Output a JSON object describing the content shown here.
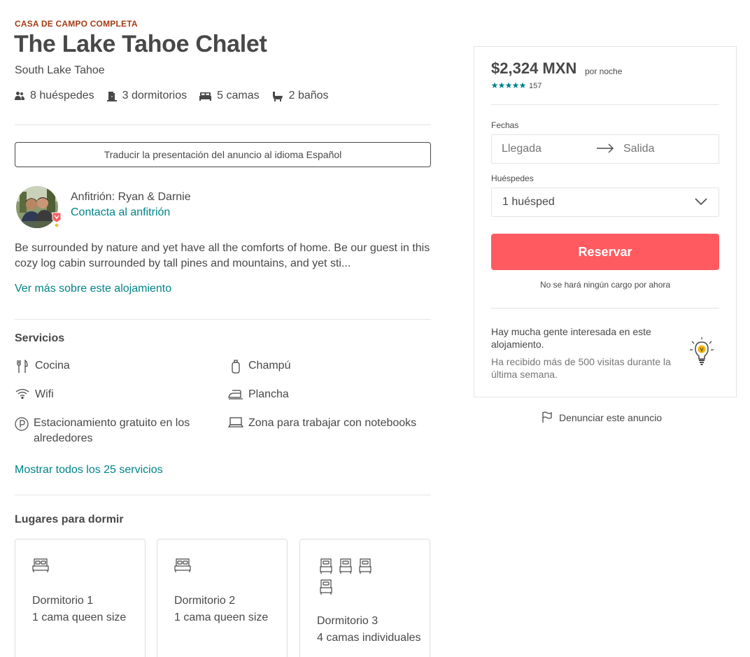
{
  "listing": {
    "kind": "CASA DE CAMPO COMPLETA",
    "title": "The Lake Tahoe Chalet",
    "location": "South Lake Tahoe",
    "summary": [
      {
        "icon": "guests-icon",
        "label": "8 huéspedes"
      },
      {
        "icon": "door-icon",
        "label": "3 dormitorios"
      },
      {
        "icon": "bed-icon",
        "label": "5 camas"
      },
      {
        "icon": "bath-icon",
        "label": "2 baños"
      }
    ],
    "translate_button": "Traducir la presentación del anuncio al idioma Español"
  },
  "host": {
    "name": "Anfitrión: Ryan & Darnie",
    "contact": "Contacta al anfitrión"
  },
  "description": {
    "text": "Be surrounded by nature and yet have all the comforts of home. Be our guest in this cozy log cabin surrounded by tall pines and mountains, and yet sti...",
    "read_more": "Ver más sobre este alojamiento"
  },
  "services": {
    "title": "Servicios",
    "items": [
      {
        "icon": "utensils-icon",
        "label": "Cocina"
      },
      {
        "icon": "shampoo-icon",
        "label": "Champú"
      },
      {
        "icon": "wifi-icon",
        "label": "Wifi"
      },
      {
        "icon": "iron-icon",
        "label": "Plancha"
      },
      {
        "icon": "parking-icon",
        "label": "Estacionamiento gratuito en los alrededores"
      },
      {
        "icon": "laptop-icon",
        "label": "Zona para trabajar con notebooks"
      }
    ],
    "show_all": "Mostrar todos los 25 servicios"
  },
  "sleeping": {
    "title": "Lugares para dormir",
    "rooms": [
      {
        "name": "Dormitorio 1",
        "beds": "1 cama queen size"
      },
      {
        "name": "Dormitorio 2",
        "beds": "1 cama queen size"
      },
      {
        "name": "Dormitorio 3",
        "beds": "4 camas individuales"
      }
    ]
  },
  "booking": {
    "price": "$2,324 MXN",
    "per_night": "por noche",
    "rating_stars": 5,
    "review_count": "157",
    "dates_label": "Fechas",
    "checkin_placeholder": "Llegada",
    "checkout_placeholder": "Salida",
    "guests_label": "Huéspedes",
    "guests_value": "1 huésped",
    "reserve_button": "Reservar",
    "no_charge": "No se hará ningún cargo por ahora",
    "popular_title": "Hay mucha gente interesada en este alojamiento.",
    "popular_sub": "Ha recibido más de 500 visitas durante la última semana.",
    "report": "Denunciar este anuncio"
  },
  "colors": {
    "accent": "#008489",
    "brand": "#ff5a5f",
    "text": "#484848",
    "kind_label": "#a63c14"
  }
}
